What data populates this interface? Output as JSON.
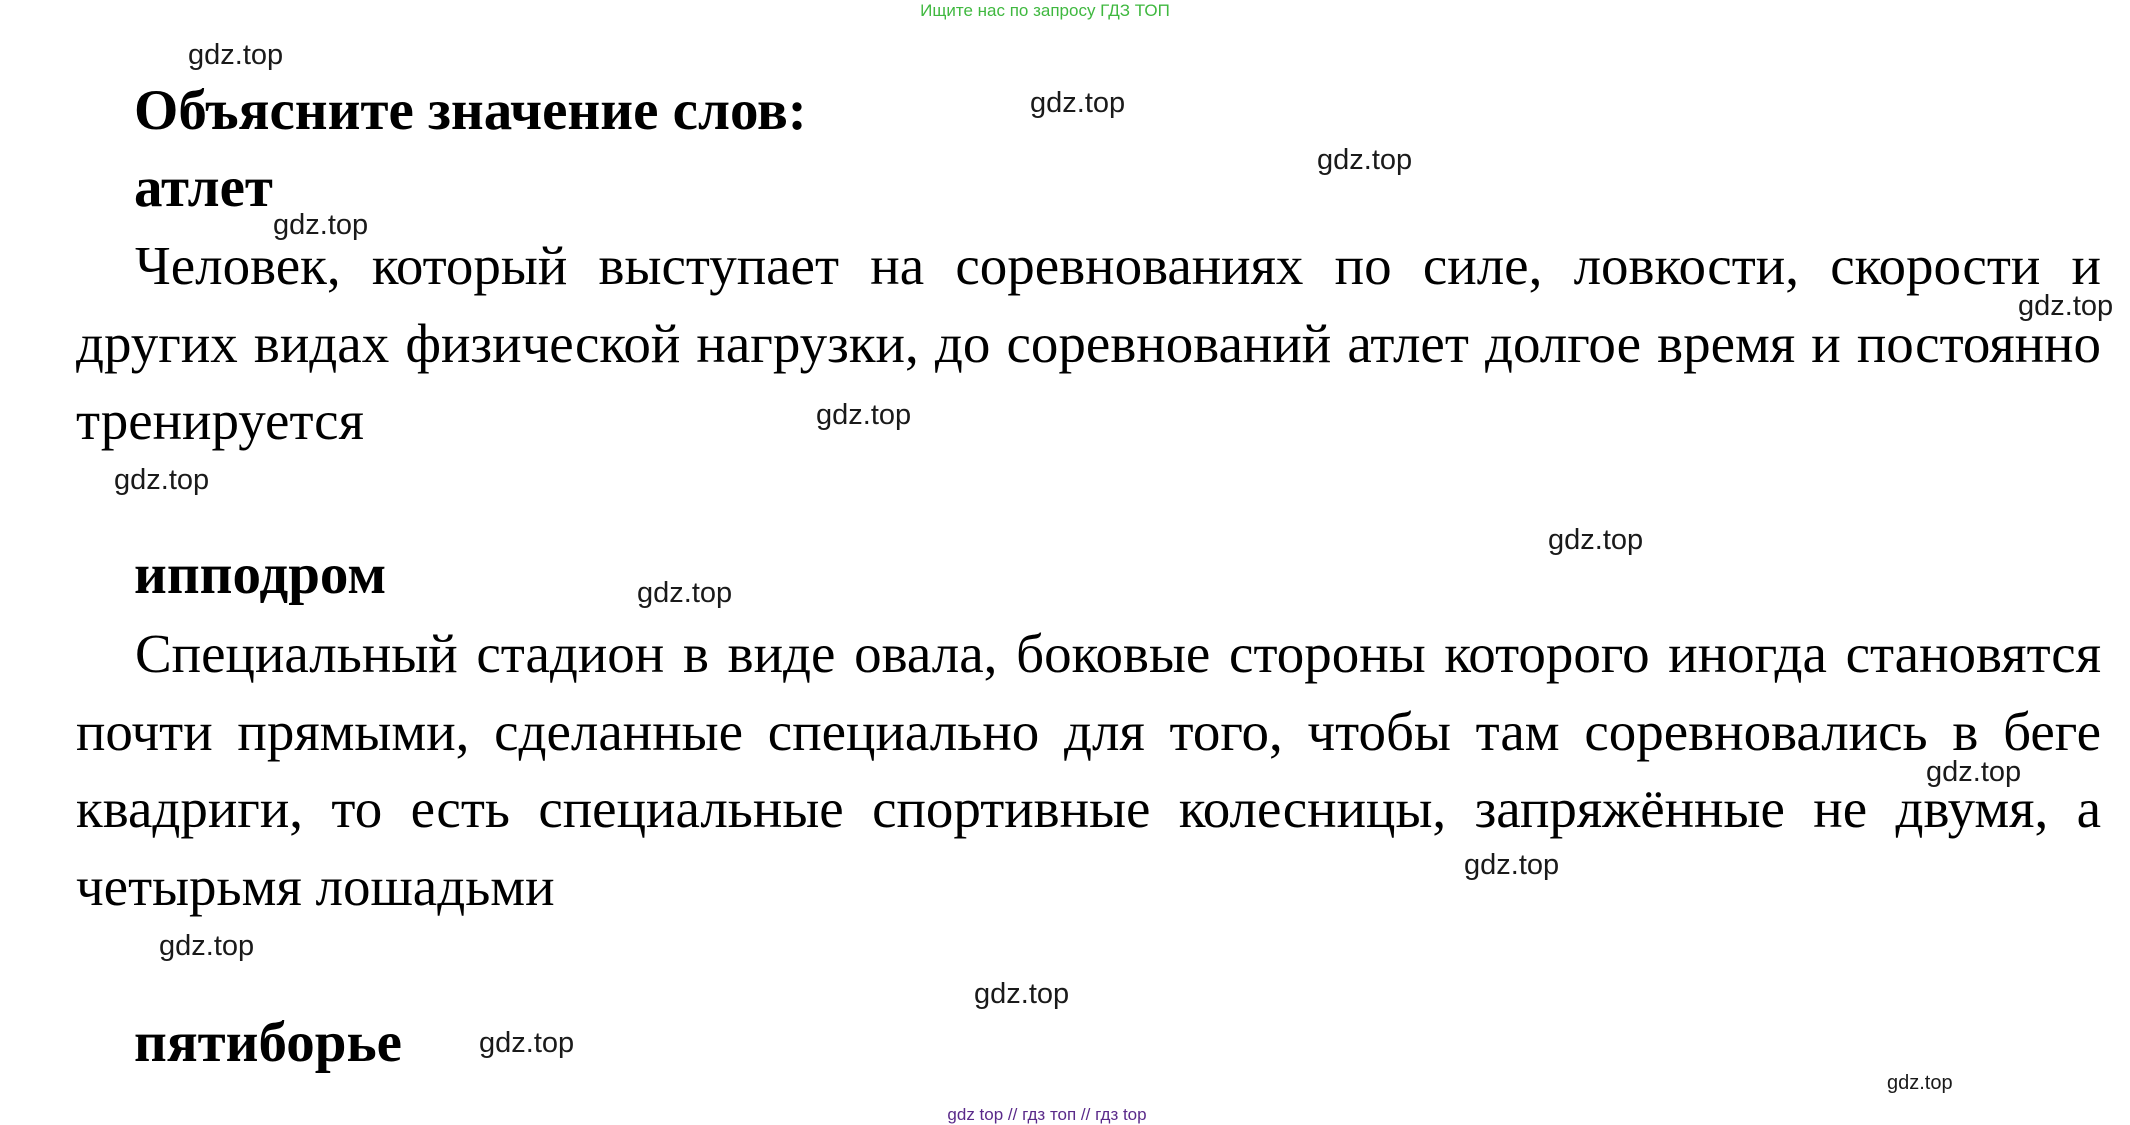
{
  "banner": "Ищите нас по запросу ГДЗ ТОП",
  "title": "Объясните значение слов:",
  "terms": [
    {
      "word": "атлет",
      "definition": "Человек, который выступает на соревнованиях по силе, ловкости, скорости и других видах физической нагрузки, до соревнований атлет долгое время и постоянно тренируется"
    },
    {
      "word": "ипподром",
      "definition": "Специальный стадион в виде овала, боковые стороны которого иногда становятся почти прямыми, сделанные специально для того, чтобы там соревновались в беге квадриги, то есть специальные спортивные колесницы, запряжённые не двумя, а четырьмя лошадьми"
    },
    {
      "word": "пятиборье",
      "definition": ""
    }
  ],
  "watermark": "gdz.top",
  "footer": "gdz top  //  гдз топ  //  гдз top",
  "colors": {
    "banner": "#3fb83f",
    "footer": "#5a2a8a",
    "text": "#000000"
  }
}
